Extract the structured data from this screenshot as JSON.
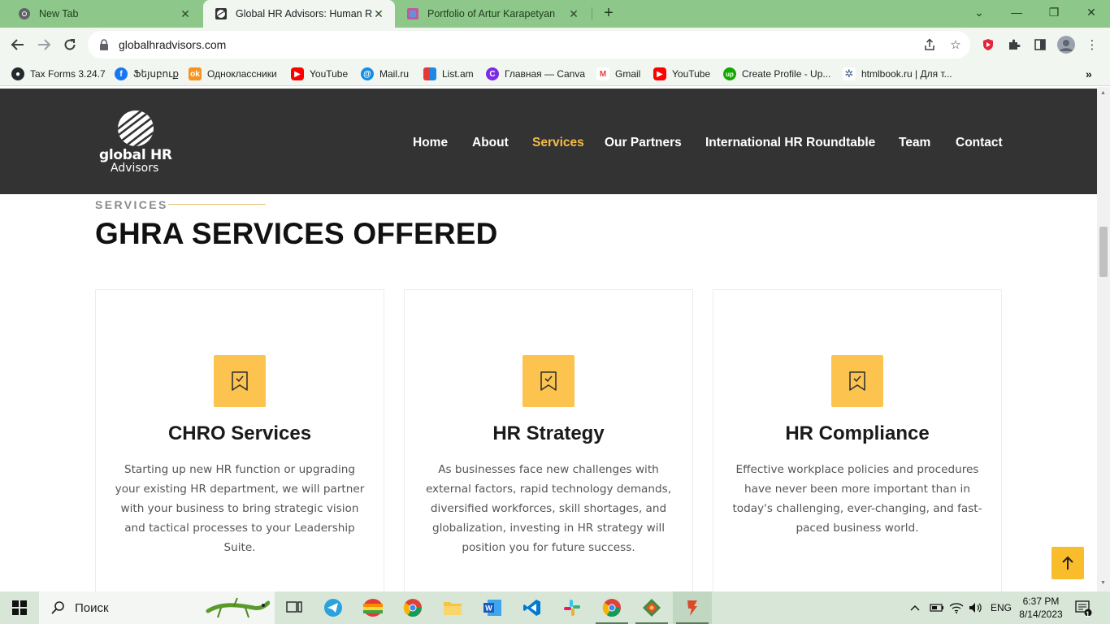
{
  "browser": {
    "tabs": [
      {
        "title": "New Tab",
        "favicon": "chrome-icon"
      },
      {
        "title": "Global HR Advisors: Human Reso",
        "favicon": "site-icon"
      },
      {
        "title": "Portfolio of Artur Karapetyan",
        "favicon": "portfolio-icon"
      }
    ],
    "url": "globalhradvisors.com",
    "bookmarks": [
      {
        "label": "Tax Forms 3.24.7",
        "icon": "github-icon",
        "color": "#24292e"
      },
      {
        "label": "Ֆեյսբուք",
        "icon": "facebook-icon",
        "color": "#1877f2"
      },
      {
        "label": "Одноклассники",
        "icon": "ok-icon",
        "color": "#f7931e"
      },
      {
        "label": "YouTube",
        "icon": "youtube-icon",
        "color": "#ff0000"
      },
      {
        "label": "Mail.ru",
        "icon": "mailru-icon",
        "color": "#168de2"
      },
      {
        "label": "List.am",
        "icon": "listam-icon",
        "color": "#e53935"
      },
      {
        "label": "Главная — Canva",
        "icon": "canva-icon",
        "color": "#7d2ae8"
      },
      {
        "label": "Gmail",
        "icon": "gmail-icon",
        "color": "#ea4335"
      },
      {
        "label": "YouTube",
        "icon": "youtube-icon",
        "color": "#ff0000"
      },
      {
        "label": "Create Profile - Up...",
        "icon": "upwork-icon",
        "color": "#14a800"
      },
      {
        "label": "htmlbook.ru | Для т...",
        "icon": "htmlbook-icon",
        "color": "#3b5b8c"
      }
    ]
  },
  "site": {
    "logo": {
      "line1": "global HR",
      "line2": "Advisors"
    },
    "nav": [
      "Home",
      "About",
      "Services",
      "Our Partners",
      "International HR Roundtable",
      "Team",
      "Contact"
    ],
    "active_nav": "Services",
    "eyebrow": "SERVICES",
    "title": "GHRA SERVICES OFFERED",
    "cards": [
      {
        "title": "CHRO Services",
        "text": "Starting up new HR function or upgrading your existing HR department, we will partner with your business to bring strategic vision and tactical processes to your Leadership Suite.",
        "icon": "bookmark-check-icon"
      },
      {
        "title": "HR Strategy",
        "text": "As businesses face new challenges with external factors, rapid technology demands, diversified workforces, skill shortages, and globalization, investing in HR strategy will position you for future success.",
        "icon": "bookmark-check-icon"
      },
      {
        "title": "HR Compliance",
        "text": "Effective workplace policies and procedures have never been more important than in today's challenging, ever-changing, and fast-paced business world.",
        "icon": "bookmark-check-icon"
      }
    ],
    "colors": {
      "header_bg": "#333333",
      "accent": "#fcc44f",
      "active_nav": "#f4bd45"
    }
  },
  "taskbar": {
    "search_placeholder": "Поиск",
    "language": "ENG",
    "time": "6:37 PM",
    "date": "8/14/2023",
    "notification_count": "1"
  }
}
